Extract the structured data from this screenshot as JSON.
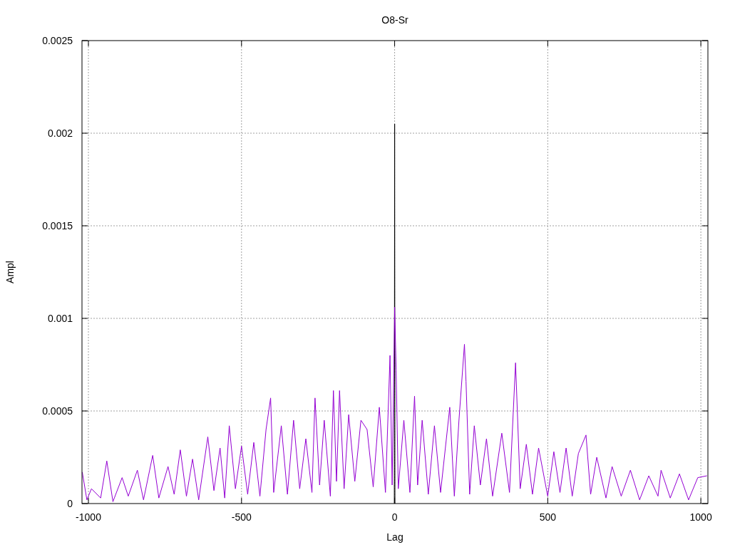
{
  "chart_data": {
    "type": "line",
    "grid": true,
    "title": "O8-Sr",
    "xlabel": "Lag",
    "ylabel": "Ampl",
    "xlim": [
      -1021,
      1023
    ],
    "ylim": [
      0,
      0.0025
    ],
    "xticks": [
      -1000,
      -500,
      0,
      500,
      1000
    ],
    "yticks": [
      {
        "value": 0,
        "label": "0"
      },
      {
        "value": 0.0005,
        "label": "0.0005"
      },
      {
        "value": 0.001,
        "label": "0.001"
      },
      {
        "value": 0.0015,
        "label": "0.0015"
      },
      {
        "value": 0.002,
        "label": "0.002"
      },
      {
        "value": 0.0025,
        "label": "0.0025"
      }
    ],
    "series": [
      {
        "color": "#9400d3",
        "x": [
          -1020,
          -1005,
          -990,
          -960,
          -940,
          -920,
          -890,
          -870,
          -840,
          -820,
          -790,
          -770,
          -740,
          -720,
          -700,
          -680,
          -660,
          -640,
          -610,
          -590,
          -570,
          -555,
          -540,
          -520,
          -500,
          -480,
          -460,
          -440,
          -420,
          -405,
          -395,
          -370,
          -350,
          -330,
          -310,
          -290,
          -270,
          -260,
          -245,
          -230,
          -210,
          -200,
          -190,
          -180,
          -165,
          -150,
          -130,
          -110,
          -90,
          -70,
          -50,
          -30,
          -15,
          -8,
          0,
          5,
          12,
          30,
          50,
          65,
          75,
          90,
          110,
          130,
          150,
          180,
          195,
          210,
          228,
          233,
          245,
          260,
          280,
          300,
          320,
          350,
          375,
          395,
          410,
          430,
          450,
          470,
          500,
          520,
          540,
          560,
          580,
          600,
          625,
          640,
          660,
          690,
          710,
          740,
          770,
          800,
          830,
          860,
          870,
          900,
          930,
          960,
          990,
          1020
        ],
        "values": [
          0.00017,
          2e-05,
          8e-05,
          3e-05,
          0.00023,
          1e-05,
          0.00014,
          4e-05,
          0.00018,
          2e-05,
          0.00026,
          3e-05,
          0.0002,
          5e-05,
          0.00029,
          4e-05,
          0.00024,
          2e-05,
          0.00036,
          7e-05,
          0.0003,
          3e-05,
          0.00042,
          8e-05,
          0.00031,
          5e-05,
          0.00033,
          4e-05,
          0.0004,
          0.00057,
          6e-05,
          0.00042,
          5e-05,
          0.00045,
          8e-05,
          0.00035,
          6e-05,
          0.00057,
          0.0001,
          0.00045,
          4e-05,
          0.00061,
          0.00012,
          0.00061,
          8e-05,
          0.00048,
          0.00012,
          0.00045,
          0.0004,
          9e-05,
          0.00052,
          6e-05,
          0.0008,
          0.0001,
          0.00106,
          0.00072,
          8e-05,
          0.00045,
          6e-05,
          0.00058,
          0.0001,
          0.00045,
          5e-05,
          0.00042,
          6e-05,
          0.00052,
          4e-05,
          0.00045,
          0.00086,
          0.00066,
          5e-05,
          0.00042,
          0.0001,
          0.00035,
          4e-05,
          0.00038,
          6e-05,
          0.00076,
          8e-05,
          0.00032,
          5e-05,
          0.0003,
          4e-05,
          0.00028,
          6e-05,
          0.0003,
          4e-05,
          0.00027,
          0.00037,
          5e-05,
          0.00025,
          3e-05,
          0.0002,
          4e-05,
          0.00018,
          2e-05,
          0.00015,
          4e-05,
          0.00018,
          3e-05,
          0.00016,
          2e-05,
          0.00014,
          0.00015
        ]
      },
      {
        "color": "#000000",
        "x": [
          -1,
          0,
          1
        ],
        "values": [
          0,
          0.00205,
          0
        ]
      }
    ]
  }
}
